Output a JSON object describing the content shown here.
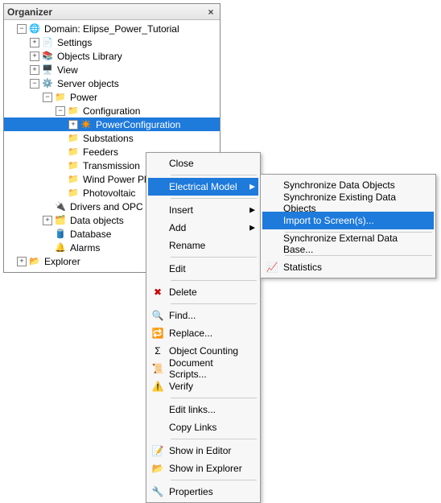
{
  "organizer": {
    "title": "Organizer",
    "tree": {
      "domain": "Domain: Elipse_Power_Tutorial",
      "settings": "Settings",
      "objects_library": "Objects Library",
      "view": "View",
      "server_objects": "Server objects",
      "power": "Power",
      "configuration": "Configuration",
      "power_configuration": "PowerConfiguration",
      "substations": "Substations",
      "feeders": "Feeders",
      "transmission": "Transmission",
      "wind_power": "Wind Power Plants",
      "photovoltaic": "Photovoltaic",
      "drivers": "Drivers and OPC",
      "data_objects": "Data objects",
      "database": "Database",
      "alarms": "Alarms",
      "explorer": "Explorer"
    }
  },
  "menu1": {
    "close": "Close",
    "electrical_model": "Electrical Model",
    "insert": "Insert",
    "add": "Add",
    "rename": "Rename",
    "edit": "Edit",
    "delete": "Delete",
    "find": "Find...",
    "replace": "Replace...",
    "object_counting": "Object Counting",
    "document_scripts": "Document Scripts...",
    "verify": "Verify",
    "edit_links": "Edit links...",
    "copy_links": "Copy Links",
    "show_in_editor": "Show in Editor",
    "show_in_explorer": "Show in Explorer",
    "properties": "Properties"
  },
  "menu2": {
    "sync_data": "Synchronize Data Objects",
    "sync_existing": "Synchronize Existing Data Objects",
    "import_screen": "Import to Screen(s)...",
    "sync_external": "Synchronize External Data Base...",
    "statistics": "Statistics"
  }
}
